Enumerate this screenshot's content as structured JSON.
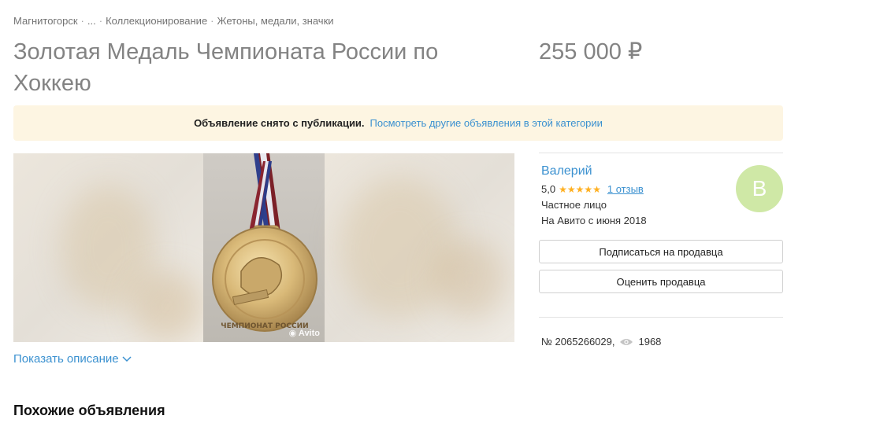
{
  "breadcrumbs": [
    {
      "label": "Магнитогорск"
    },
    {
      "label": "..."
    },
    {
      "label": "Коллекционирование"
    },
    {
      "label": "Жетоны, медали, значки"
    }
  ],
  "title": "Золотая Медаль Чемпионата России по Хоккею",
  "price": "255 000 ₽",
  "notice": {
    "text": "Объявление снято с публикации.",
    "link": "Посмотреть другие объявления в этой категории"
  },
  "gallery": {
    "watermark": "Avito"
  },
  "description_toggle": "Показать описание",
  "similar_heading": "Похожие объявления",
  "seller": {
    "name": "Валерий",
    "rating": "5,0",
    "stars": 5,
    "reviews": "1 отзыв",
    "type": "Частное лицо",
    "since": "На Авито с июня 2018",
    "avatar_letter": "В",
    "subscribe_label": "Подписаться на продавца",
    "rate_label": "Оценить продавца"
  },
  "ad": {
    "number": "№ 2065266029,",
    "views": "1968"
  },
  "colors": {
    "link": "#3b91d0",
    "notice_bg": "#fdf5e2",
    "avatar_bg": "#cfe8a6",
    "star": "#ffb021"
  },
  "icons": [
    "chevron-down-icon",
    "eye-icon",
    "camera-icon",
    "star-icon"
  ]
}
